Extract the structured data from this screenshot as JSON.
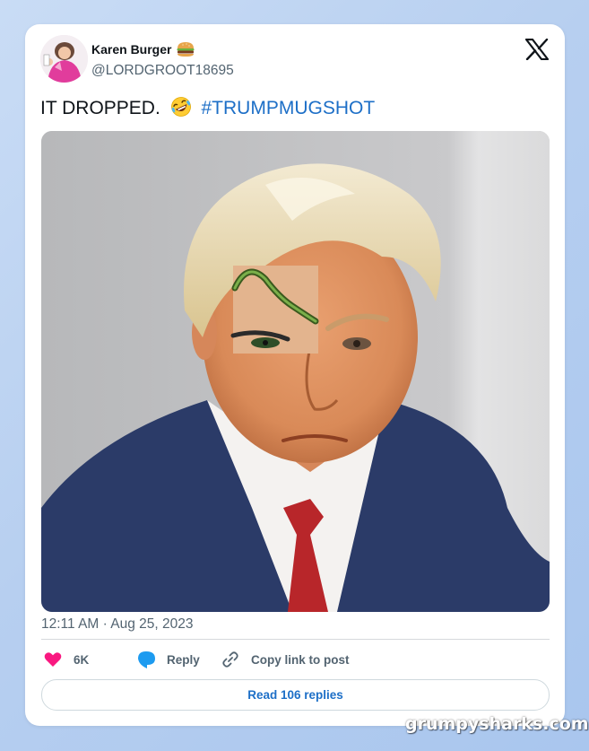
{
  "author": {
    "display_name": "Karen Burger",
    "name_emoji": "hamburger-emoji",
    "handle": "@LORDGROOT18695"
  },
  "tweet": {
    "text": "IT DROPPED.",
    "emoji": "rolling-on-floor-laughing-emoji",
    "hashtag": "#TRUMPMUGSHOT"
  },
  "photo": {
    "icon": "mugshot-photo-with-pasted-eye-and-eyebrow"
  },
  "meta": {
    "timestamp": "12:11 AM · Aug 25, 2023"
  },
  "actions": {
    "like_count": "6K",
    "reply_label": "Reply",
    "copy_link_label": "Copy link to post"
  },
  "read_replies_label": "Read 106 replies",
  "watermark": "grumpysharks.com",
  "colors": {
    "link": "#1d6fc7",
    "like_heart": "#f91880",
    "reply_bubble": "#1d9bf0",
    "text_primary": "#0f1419",
    "text_secondary": "#536471"
  }
}
